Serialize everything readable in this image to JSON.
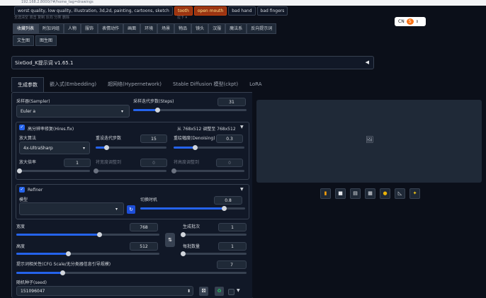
{
  "browser": {
    "url": "192.168.2.8000/?#/home_tag=drawings"
  },
  "negative_chips": [
    {
      "label": "worst quality, low quality, illustration, 3d,2d, painting, cartoons, sketch",
      "style": "wide"
    },
    {
      "label": "tooth",
      "style": "hl"
    },
    {
      "label": "open mouth",
      "style": "hl"
    },
    {
      "label": "bad hand",
      "style": ""
    },
    {
      "label": "bad fingers",
      "style": ""
    }
  ],
  "sub_row_text": "全选清空  双击  复制  反向  分类  删除",
  "sub_row_text2": "拉下 ▾",
  "category_tabs": [
    "收藏列表",
    "附加词组",
    "人物",
    "服饰",
    "表情动作",
    "画面",
    "环境",
    "场景",
    "物品",
    "镜头",
    "汉服",
    "魔法系",
    "反向提示词"
  ],
  "mode_tabs": [
    "文生图",
    "图生图"
  ],
  "lang_select": {
    "value": "CN"
  },
  "sixgod": {
    "title": "SixGod_K提示词 v1.65.1",
    "toggle": "◀"
  },
  "main_tabs": [
    "生成参数",
    "嵌入式(Embedding)",
    "超网络(Hypernetwork)",
    "Stable Diffusion 模型(ckpt)",
    "LoRA"
  ],
  "sampler": {
    "label": "采样器(Sampler)",
    "value": "Euler a"
  },
  "steps": {
    "label": "采样迭代步数(Steps)",
    "value": "31",
    "fraction": 0.21
  },
  "hires": {
    "label": "高分辨率修复(Hires.fix)",
    "resize_info": "从 768x512  调整至 768x512",
    "upscaler_label": "放大算法",
    "upscaler_value": "4x-UltraSharp",
    "hires_steps_label": "重设迭代步数",
    "hires_steps_value": "15",
    "hires_steps_fraction": 0.15,
    "denoise_label": "重绘幅度(Denoising)",
    "denoise_value": "0.3",
    "denoise_fraction": 0.3,
    "scale_label": "放大倍率",
    "scale_value": "1",
    "scale_fraction": 0.0,
    "resize_w_label": "将宽度调整到",
    "resize_w_value": "0",
    "resize_h_label": "将高度调整到",
    "resize_h_value": "0"
  },
  "refiner": {
    "label": "Refiner",
    "model_label": "模型",
    "switch_label": "切换时机",
    "switch_value": "0.8",
    "switch_fraction": 0.8
  },
  "width": {
    "label": "宽度",
    "value": "768",
    "fraction": 0.58
  },
  "height": {
    "label": "高度",
    "value": "512",
    "fraction": 0.36
  },
  "batch_count": {
    "label": "生成批次",
    "value": "1",
    "fraction": 0.0
  },
  "batch_size": {
    "label": "每批数量",
    "value": "1",
    "fraction": 0.0
  },
  "cfg": {
    "label": "提示词相关性(CFG Scale/无分类器信息引导规模)",
    "value": "7",
    "fraction": 0.2
  },
  "seed": {
    "label": "随机种子(seed)",
    "value": "151096047"
  },
  "swap_icon": "⇅",
  "toolbar_icons": [
    "folder",
    "save",
    "zip",
    "image",
    "palette",
    "ruler",
    "sparkle"
  ],
  "colors": {
    "accent": "#2563eb",
    "bg": "#0b0f19",
    "panel": "#111827",
    "chip_highlight": "#9a3412"
  }
}
